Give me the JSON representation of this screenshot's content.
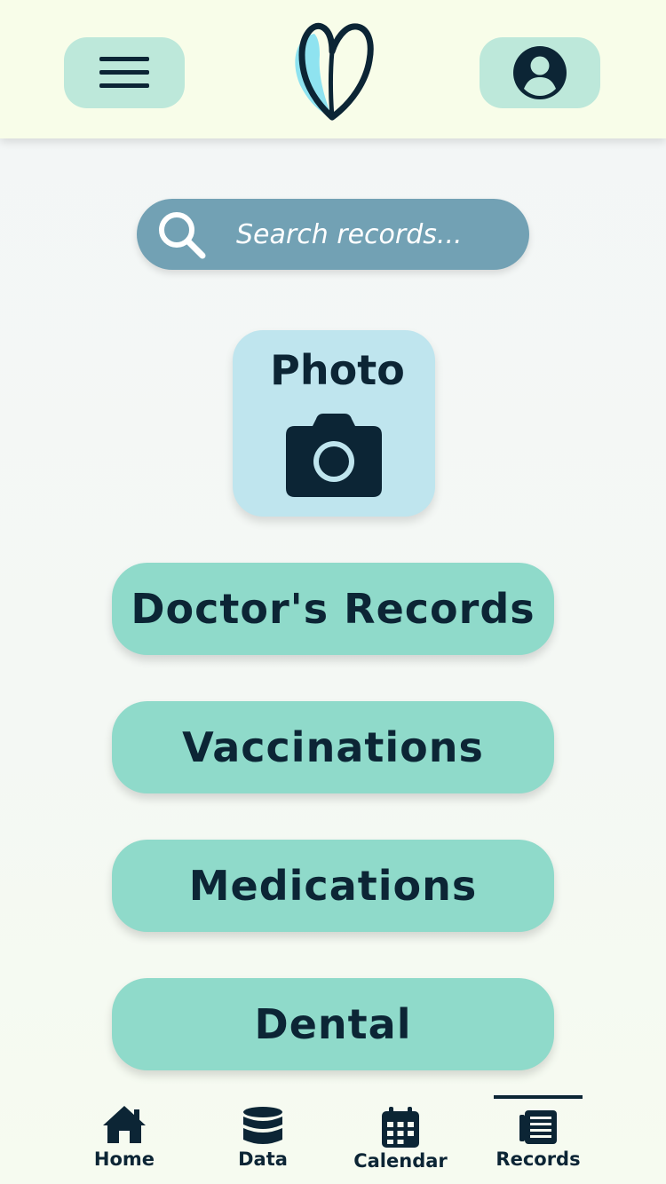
{
  "header": {
    "menu_icon": "hamburger-menu-icon",
    "logo_icon": "heart-leaf-logo",
    "profile_icon": "user-account-icon"
  },
  "search": {
    "placeholder": "Search records...",
    "value": "",
    "icon": "search-icon"
  },
  "photo": {
    "label": "Photo",
    "icon": "camera-icon"
  },
  "records": {
    "buttons": [
      {
        "label": "Doctor's Records"
      },
      {
        "label": "Vaccinations"
      },
      {
        "label": "Medications"
      },
      {
        "label": "Dental"
      }
    ]
  },
  "nav": {
    "items": [
      {
        "label": "Home",
        "icon": "home-icon",
        "active": false
      },
      {
        "label": "Data",
        "icon": "database-icon",
        "active": false
      },
      {
        "label": "Calendar",
        "icon": "calendar-icon",
        "active": false
      },
      {
        "label": "Records",
        "icon": "records-icon",
        "active": true
      }
    ]
  },
  "colors": {
    "header_bg": "#f8fde9",
    "pill_bg": "#bde8da",
    "search_bg": "#72a1b4",
    "photo_card_bg": "#bfe5ee",
    "button_bg": "#8fdaca",
    "text_dark": "#0c2535",
    "logo_accent": "#8fe3f0"
  }
}
